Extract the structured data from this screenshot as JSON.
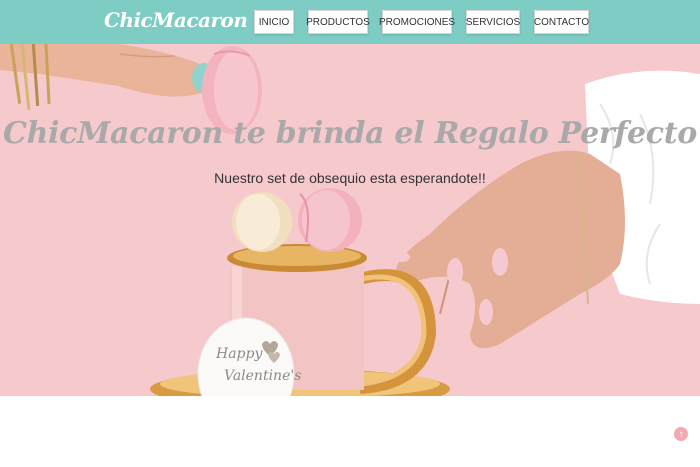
{
  "brand": {
    "name": "ChicMacaron"
  },
  "nav": {
    "items": [
      {
        "label": "INICIO"
      },
      {
        "label": "PRODUCTOS"
      },
      {
        "label": "PROMOCIONES"
      },
      {
        "label": "SERVICIOS"
      },
      {
        "label": "CONTACTO"
      }
    ]
  },
  "hero": {
    "headline": "ChicMacaron te brinda el Regalo Perfecto",
    "subline": "Nuestro set de obsequio esta esperandote!!",
    "card_line1": "Happy",
    "card_line2": "Valentine's"
  },
  "icons": {
    "scroll_top": "arrow-up-icon"
  },
  "colors": {
    "nav_bg": "#7ecdc4",
    "hero_bg": "#f6c9cd",
    "headline": "#a9a9a9",
    "scroll_top": "#f2a9b4"
  }
}
